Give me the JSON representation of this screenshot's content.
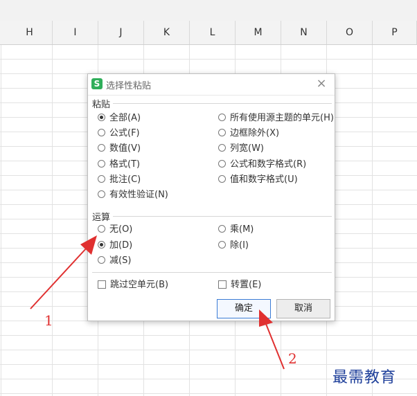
{
  "columns": [
    "H",
    "I",
    "J",
    "K",
    "L",
    "M",
    "N",
    "O",
    "P"
  ],
  "dialog": {
    "title": "选择性粘贴",
    "close_glyph": "×",
    "paste_section": "粘贴",
    "paste_left": [
      {
        "label": "全部(A)",
        "selected": true
      },
      {
        "label": "公式(F)",
        "selected": false
      },
      {
        "label": "数值(V)",
        "selected": false
      },
      {
        "label": "格式(T)",
        "selected": false
      },
      {
        "label": "批注(C)",
        "selected": false
      },
      {
        "label": "有效性验证(N)",
        "selected": false
      }
    ],
    "paste_right": [
      {
        "label": "所有使用源主题的单元(H)",
        "selected": false
      },
      {
        "label": "边框除外(X)",
        "selected": false
      },
      {
        "label": "列宽(W)",
        "selected": false
      },
      {
        "label": "公式和数字格式(R)",
        "selected": false
      },
      {
        "label": "值和数字格式(U)",
        "selected": false
      }
    ],
    "operation_section": "运算",
    "op_left": [
      {
        "label": "无(O)",
        "selected": false
      },
      {
        "label": "加(D)",
        "selected": true
      },
      {
        "label": "减(S)",
        "selected": false
      }
    ],
    "op_right": [
      {
        "label": "乘(M)",
        "selected": false
      },
      {
        "label": "除(I)",
        "selected": false
      }
    ],
    "skip_blanks": "跳过空单元(B)",
    "transpose": "转置(E)",
    "ok": "确定",
    "cancel": "取消"
  },
  "annotations": {
    "one": "1",
    "two": "2",
    "arrow_color": "#e03030"
  },
  "watermark": "最需教育"
}
